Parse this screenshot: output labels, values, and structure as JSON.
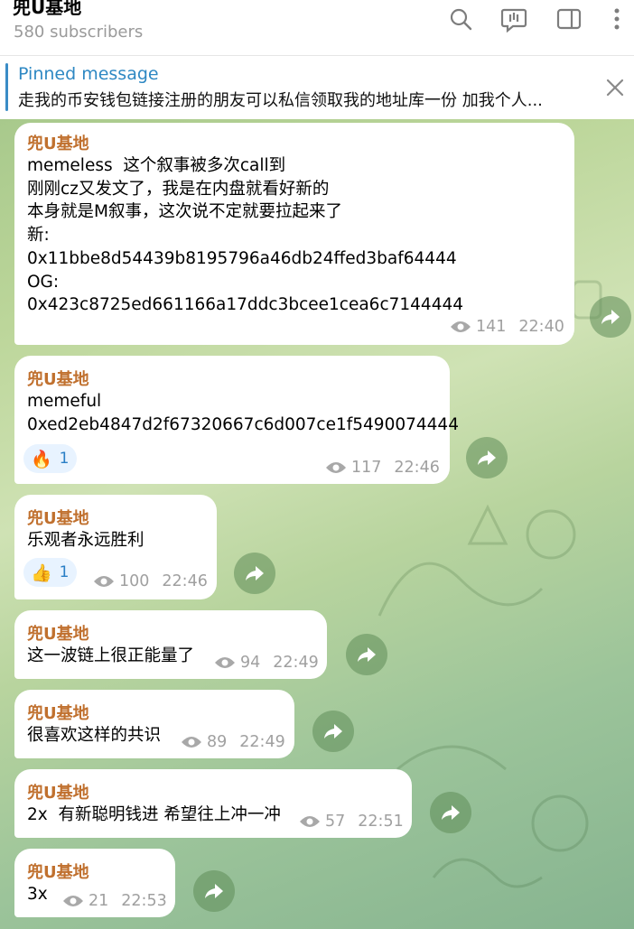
{
  "header": {
    "title": "兜U基地",
    "subscribers": "580 subscribers",
    "icons": [
      "search-icon",
      "channel-chat-icon",
      "sidebar-toggle-icon",
      "more-icon"
    ]
  },
  "pinned": {
    "label": "Pinned message",
    "text": "走我的币安钱包链接注册的朋友可以私信领取我的地址库一份 加我个人..."
  },
  "messages": [
    {
      "sender": "兜U基地",
      "text": "memeless  这个叙事被多次call到\n刚刚cz又发文了，我是在内盘就看好新的\n本身就是M叙事，这次说不定就要拉起来了\n新:\n0x11bbe8d54439b8195796a46db24ffed3baf64444\nOG:\n0x423c8725ed661166a17ddc3bcee1cea6c7144444",
      "views": "141",
      "time": "22:40"
    },
    {
      "sender": "兜U基地",
      "text": "memeful\n0xed2eb4847d2f67320667c6d007ce1f5490074444",
      "reaction_emoji": "🔥",
      "reaction_count": "1",
      "views": "117",
      "time": "22:46"
    },
    {
      "sender": "兜U基地",
      "text": "乐观者永远胜利",
      "reaction_emoji": "👍",
      "reaction_count": "1",
      "views": "100",
      "time": "22:46"
    },
    {
      "sender": "兜U基地",
      "text": "这一波链上很正能量了",
      "views": "94",
      "time": "22:49"
    },
    {
      "sender": "兜U基地",
      "text": "很喜欢这样的共识",
      "views": "89",
      "time": "22:49"
    },
    {
      "sender": "兜U基地",
      "text": "2x  有新聪明钱进 希望往上冲一冲",
      "views": "57",
      "time": "22:51"
    },
    {
      "sender": "兜U基地",
      "text": "3x",
      "views": "21",
      "time": "22:53"
    }
  ],
  "colors": {
    "sender": "#c0702e",
    "pinned_accent": "#2e88c3",
    "meta": "#a0a0a0",
    "reaction_bg": "#e8f3ff"
  }
}
